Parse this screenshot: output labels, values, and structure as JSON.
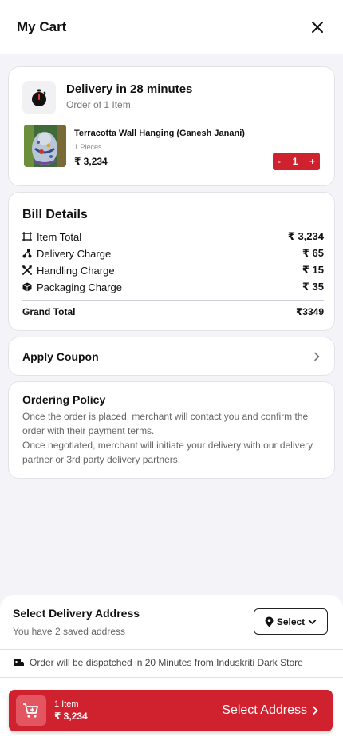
{
  "header": {
    "title": "My Cart",
    "close_icon": "close-icon"
  },
  "delivery": {
    "title": "Delivery in 28 minutes",
    "subtitle": "Order of 1 Item",
    "icon": "stopwatch-icon",
    "product": {
      "name": "Terracotta Wall Hanging (Ganesh Janani)",
      "pieces": "1 Pieces",
      "price": "₹ 3,234",
      "stepper": {
        "minus": "-",
        "quantity": "1",
        "plus": "+"
      }
    }
  },
  "bill": {
    "title": "Bill Details",
    "rows": [
      {
        "label": "Item Total",
        "amount": "₹ 3,234",
        "icon": "receipt-icon"
      },
      {
        "label": "Delivery Charge",
        "amount": "₹ 65",
        "icon": "scooter-icon"
      },
      {
        "label": "Handling Charge",
        "amount": "₹ 15",
        "icon": "tools-icon"
      },
      {
        "label": "Packaging Charge",
        "amount": "₹ 35",
        "icon": "package-icon"
      }
    ],
    "grand_total_label": "Grand Total",
    "grand_total_value": "₹3349"
  },
  "coupon": {
    "label": "Apply Coupon",
    "icon": "chevron-right-icon"
  },
  "policy": {
    "title": "Ordering Policy",
    "text": "Once the order is placed, merchant will contact you and confirm the order with their payment terms.\nOnce negotiated, merchant will initiate your delivery with our delivery partner or 3rd party delivery partners."
  },
  "address": {
    "title": "Select Delivery Address",
    "subtitle": "You have 2 saved address",
    "select_label": "Select",
    "dispatch_text": "Order will be dispatched in 20 Minutes from Induskriti Dark Store"
  },
  "cta": {
    "items": "1 Item",
    "total": "₹ 3,234",
    "action": "Select Address"
  },
  "colors": {
    "accent": "#d0212f",
    "background": "#f4f4f8"
  }
}
